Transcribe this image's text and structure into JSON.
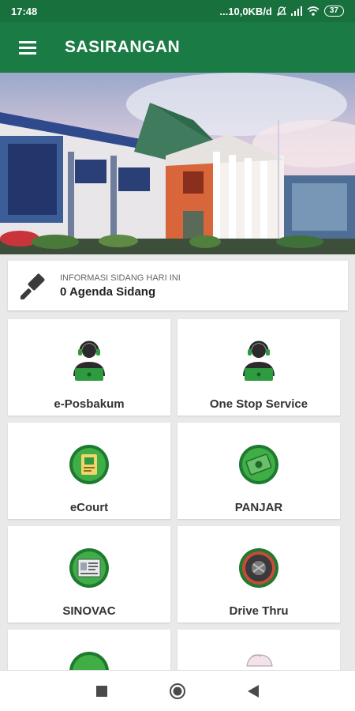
{
  "status_bar": {
    "time": "17:48",
    "network_speed": "...10,0KB/d",
    "battery": "37"
  },
  "app_bar": {
    "title": "SASIRANGAN",
    "menu_icon": "hamburger-menu-icon"
  },
  "info": {
    "label": "INFORMASI SIDANG HARI INI",
    "value": "0 Agenda Sidang",
    "icon": "gavel-icon"
  },
  "menu": [
    {
      "label": "e-Posbakum",
      "icon": "support-agent-icon"
    },
    {
      "label": "One Stop Service",
      "icon": "support-agent-icon"
    },
    {
      "label": "eCourt",
      "icon": "ecourt-icon"
    },
    {
      "label": "PANJAR",
      "icon": "money-icon"
    },
    {
      "label": "SINOVAC",
      "icon": "document-icon"
    },
    {
      "label": "Drive Thru",
      "icon": "drive-thru-icon"
    },
    {
      "label": "",
      "icon": "ecourt-icon"
    },
    {
      "label": "",
      "icon": "hand-icon"
    }
  ],
  "colors": {
    "primary": "#1a7b44",
    "status_bar": "#18703d",
    "icon_green": "#2e9b3e",
    "background": "#e9e9e9"
  }
}
